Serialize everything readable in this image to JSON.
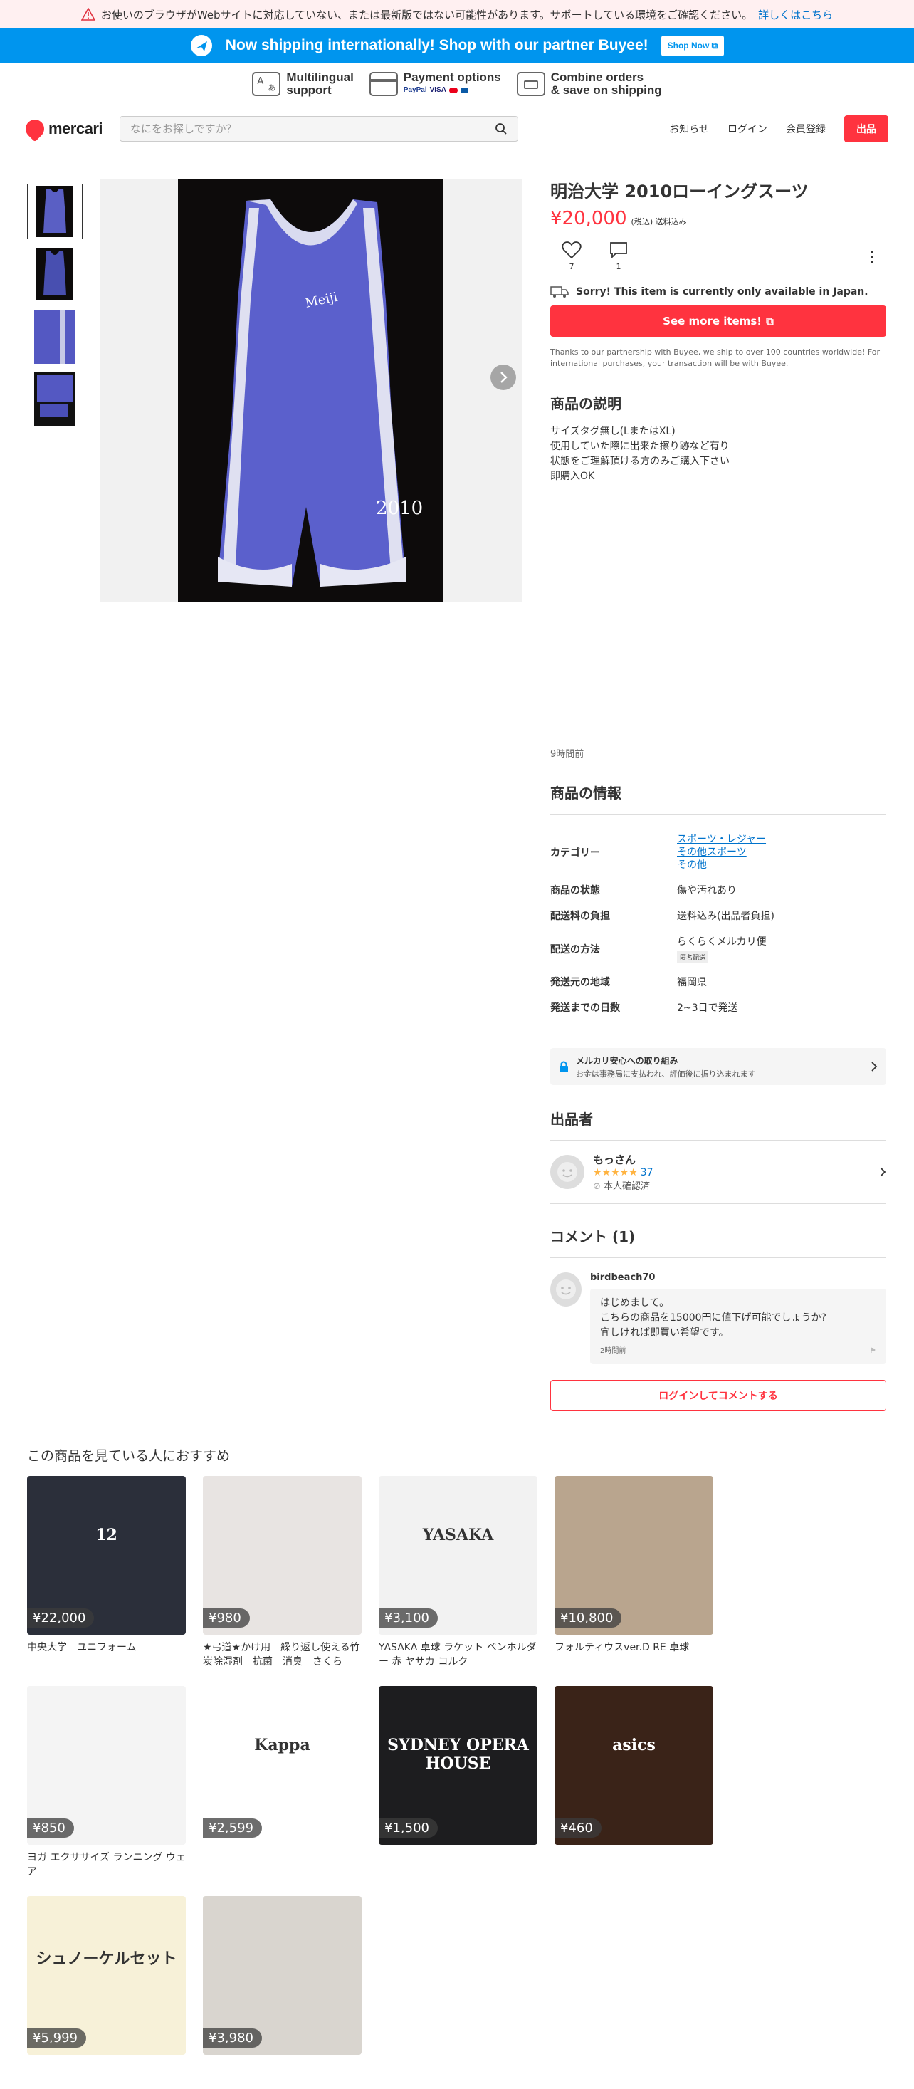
{
  "warning": {
    "text": "お使いのブラウザがWebサイトに対応していない、または最新版ではない可能性があります。サポートしている環境をご確認ください。",
    "link": "詳しくはこちら"
  },
  "shipbar": {
    "text": "Now shipping internationally! Shop with our partner Buyee!",
    "button": "Shop Now"
  },
  "features": [
    {
      "line1": "Multilingual",
      "line2": "support"
    },
    {
      "line1": "Payment options",
      "line2": "PayPal VISA"
    },
    {
      "line1": "Combine orders",
      "line2": "& save on shipping"
    }
  ],
  "header": {
    "logo": "mercari",
    "search_placeholder": "なにをお探しですか？",
    "nav": [
      "お知らせ",
      "ログイン",
      "会員登録"
    ],
    "list_button": "出品"
  },
  "item": {
    "title": "明治大学 2010ローイングスーツ",
    "price": "¥20,000",
    "tax_note": "(税込) 送料込み",
    "likes": "7",
    "comments": "1",
    "sorry": "Sorry! This item is currently only available in Japan.",
    "see_more": "See more items!",
    "buyee_note": "Thanks to our partnership with Buyee, we ship to over 100 countries worldwide! For international purchases, your transaction will be with Buyee.",
    "desc_heading": "商品の説明",
    "desc_lines": [
      "サイズタグ無し(LまたはXL)",
      "使用していた際に出来た擦り跡など有り",
      "状態をご理解頂ける方のみご購入下さい",
      "即購入OK"
    ],
    "posted": "9時間前",
    "photo_text": "2010"
  },
  "info": {
    "heading": "商品の情報",
    "category_label": "カテゴリー",
    "category": [
      "スポーツ・レジャー",
      "その他スポーツ",
      "その他"
    ],
    "rows": [
      {
        "k": "商品の状態",
        "v": "傷や汚れあり"
      },
      {
        "k": "配送料の負担",
        "v": "送料込み(出品者負担)"
      },
      {
        "k": "配送の方法",
        "v": "らくらくメルカリ便",
        "tag": "匿名配送"
      },
      {
        "k": "発送元の地域",
        "v": "福岡県"
      },
      {
        "k": "発送までの日数",
        "v": "2~3日で発送"
      }
    ],
    "safe_title": "メルカリ安心への取り組み",
    "safe_sub": "お金は事務局に支払われ、評価後に振り込まれます"
  },
  "seller": {
    "heading": "出品者",
    "name": "もっさん",
    "rating_count": "37",
    "verified": "本人確認済"
  },
  "comment_section": {
    "heading": "コメント (1)",
    "user": "birdbeach70",
    "lines": [
      "はじめまして。",
      "こちらの商品を15000円に値下げ可能でしょうか?",
      "宜しければ即買い希望です。"
    ],
    "time": "2時間前",
    "login_button": "ログインしてコメントする"
  },
  "recommend": {
    "heading": "この商品を見ている人におすすめ",
    "items": [
      {
        "price": "¥22,000",
        "name": "中央大学　ユニフォーム",
        "bg": "#2b2f3a",
        "img_text": "12"
      },
      {
        "price": "¥980",
        "name": "★弓道★かけ用　繰り返し使える竹炭除湿剤　抗菌　消臭　さくら",
        "bg": "#e8e4e2",
        "img_text": ""
      },
      {
        "price": "¥3,100",
        "name": "YASAKA 卓球 ラケット ペンホルダー 赤 ヤサカ コルク",
        "bg": "#f2f2f2",
        "img_text": "YASAKA"
      },
      {
        "price": "¥10,800",
        "name": "フォルティウスver.D RE 卓球",
        "bg": "#b9a58e",
        "img_text": ""
      },
      {
        "price": "¥850",
        "name": "ヨガ エクササイズ ランニング ウェア",
        "bg": "#f4f4f4",
        "img_text": ""
      },
      {
        "price": "¥2,599",
        "name": "",
        "bg": "#ffffff",
        "img_text": "Kappa"
      },
      {
        "price": "¥1,500",
        "name": "",
        "bg": "#1d1d1f",
        "img_text": "SYDNEY OPERA HOUSE"
      },
      {
        "price": "¥460",
        "name": "",
        "bg": "#3a2318",
        "img_text": "asics"
      },
      {
        "price": "¥5,999",
        "name": "",
        "bg": "#f7f1d8",
        "img_text": "シュノーケルセット"
      },
      {
        "price": "¥3,980",
        "name": "",
        "bg": "#d9d5cf",
        "img_text": ""
      }
    ]
  }
}
